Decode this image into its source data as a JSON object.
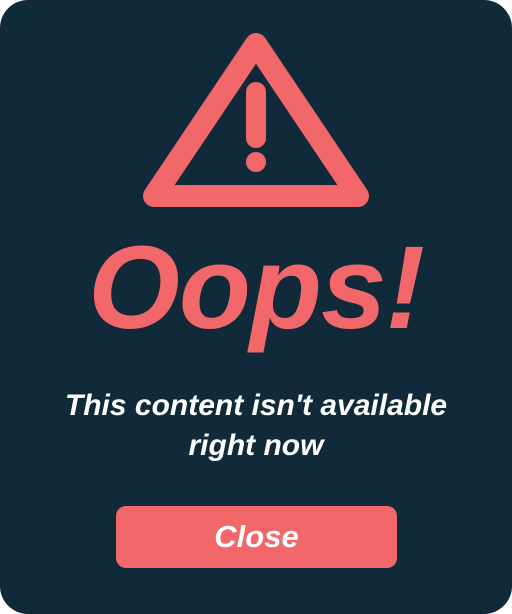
{
  "dialog": {
    "icon": "warning-triangle-icon",
    "title": "Oops!",
    "message": "This content isn't available right now",
    "close_label": "Close"
  },
  "colors": {
    "background": "#112a39",
    "accent": "#f2676a",
    "text": "#ffffff"
  }
}
